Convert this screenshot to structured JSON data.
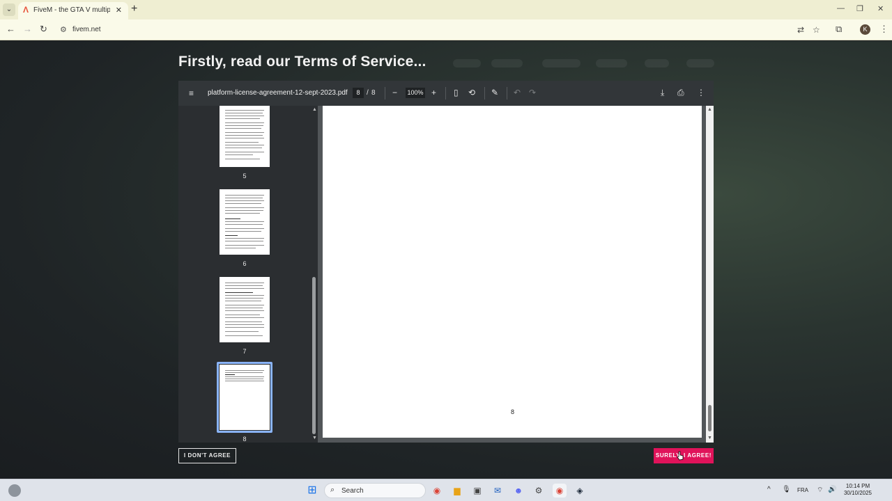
{
  "browser": {
    "tab_title": "FiveM - the GTA V multiplayer",
    "tab_close": "✕",
    "new_tab": "+",
    "url": "fivem.net",
    "profile_initial": "K"
  },
  "page": {
    "title": "Firstly, read our Terms of Service..."
  },
  "pdf": {
    "filename": "platform-license-agreement-12-sept-2023.pdf",
    "current_page": "8",
    "separator": "/",
    "total_pages": "8",
    "zoom": "100%",
    "thumbnails": [
      {
        "label": "5"
      },
      {
        "label": "6"
      },
      {
        "label": "7"
      },
      {
        "label": "8"
      }
    ],
    "page_footer_number": "8",
    "selected_thumbnail": 4
  },
  "actions": {
    "disagree_label": "I DON'T AGREE",
    "agree_label": "SURELY, I AGREE!",
    "agree_color": "#e0135a"
  },
  "taskbar": {
    "search_placeholder": "Search",
    "language": "FRA",
    "time": "10:14 PM",
    "date": "30/10/2025"
  }
}
